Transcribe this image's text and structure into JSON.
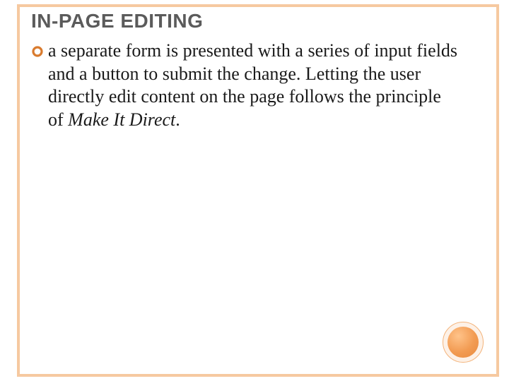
{
  "slide": {
    "title": "IN-PAGE EDITING",
    "bullet_text_main": "a separate form is presented with a series of input fields and a button to submit the change. Letting the user directly edit content on the page follows the principle of ",
    "principle": "Make It Direct",
    "period": "."
  },
  "theme": {
    "accent": "#f6c9a0",
    "accent_strong": "#f29b52",
    "title_color": "#5b5b5b"
  }
}
